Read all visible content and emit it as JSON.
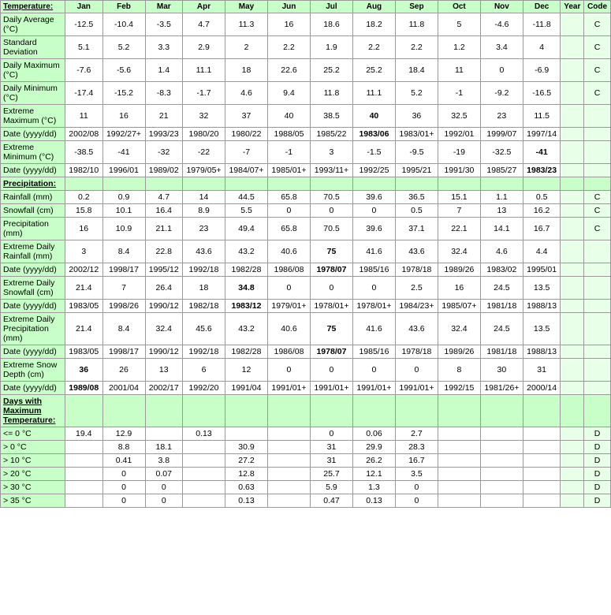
{
  "headers": {
    "row_label": "Temperature:",
    "months": [
      "Jan",
      "Feb",
      "Mar",
      "Apr",
      "May",
      "Jun",
      "Jul",
      "Aug",
      "Sep",
      "Oct",
      "Nov",
      "Dec",
      "Year",
      "Code"
    ]
  },
  "rows": [
    {
      "label": "Daily Average (°C)",
      "values": [
        "-12.5",
        "-10.4",
        "-3.5",
        "4.7",
        "11.3",
        "16",
        "18.6",
        "18.2",
        "11.8",
        "5",
        "-4.6",
        "-11.8",
        "",
        "C"
      ],
      "bold_indices": []
    },
    {
      "label": "Standard Deviation",
      "values": [
        "5.1",
        "5.2",
        "3.3",
        "2.9",
        "2",
        "2.2",
        "1.9",
        "2.2",
        "2.2",
        "1.2",
        "3.4",
        "4",
        "",
        "C"
      ],
      "bold_indices": []
    },
    {
      "label": "Daily Maximum (°C)",
      "values": [
        "-7.6",
        "-5.6",
        "1.4",
        "11.1",
        "18",
        "22.6",
        "25.2",
        "25.2",
        "18.4",
        "11",
        "0",
        "-6.9",
        "",
        "C"
      ],
      "bold_indices": []
    },
    {
      "label": "Daily Minimum (°C)",
      "values": [
        "-17.4",
        "-15.2",
        "-8.3",
        "-1.7",
        "4.6",
        "9.4",
        "11.8",
        "11.1",
        "5.2",
        "-1",
        "-9.2",
        "-16.5",
        "",
        "C"
      ],
      "bold_indices": []
    },
    {
      "label": "Extreme Maximum (°C)",
      "values": [
        "11",
        "16",
        "21",
        "32",
        "37",
        "40",
        "38.5",
        "40",
        "36",
        "32.5",
        "23",
        "11.5",
        "",
        ""
      ],
      "bold_indices": [
        7
      ]
    },
    {
      "label": "Date (yyyy/dd)",
      "values": [
        "2002/08",
        "1992/27+",
        "1993/23",
        "1980/20",
        "1980/22",
        "1988/05",
        "1985/22",
        "1983/06",
        "1983/01+",
        "1992/01",
        "1999/07",
        "1997/14",
        "",
        ""
      ],
      "bold_indices": [
        7
      ]
    },
    {
      "label": "Extreme Minimum (°C)",
      "values": [
        "-38.5",
        "-41",
        "-32",
        "-22",
        "-7",
        "-1",
        "3",
        "-1.5",
        "-9.5",
        "-19",
        "-32.5",
        "-41",
        "",
        ""
      ],
      "bold_indices": [
        11
      ]
    },
    {
      "label": "Date (yyyy/dd)",
      "values": [
        "1982/10",
        "1996/01",
        "1989/02",
        "1979/05+",
        "1984/07+",
        "1985/01+",
        "1993/11+",
        "1992/25",
        "1995/21",
        "1991/30",
        "1985/27",
        "1983/23",
        "",
        ""
      ],
      "bold_indices": [
        11
      ]
    },
    {
      "label": "Precipitation:",
      "section": true,
      "values": [
        "",
        "",
        "",
        "",
        "",
        "",
        "",
        "",
        "",
        "",
        "",
        "",
        "",
        ""
      ],
      "bold_indices": []
    },
    {
      "label": "Rainfall (mm)",
      "values": [
        "0.2",
        "0.9",
        "4.7",
        "14",
        "44.5",
        "65.8",
        "70.5",
        "39.6",
        "36.5",
        "15.1",
        "1.1",
        "0.5",
        "",
        "C"
      ],
      "bold_indices": []
    },
    {
      "label": "Snowfall (cm)",
      "values": [
        "15.8",
        "10.1",
        "16.4",
        "8.9",
        "5.5",
        "0",
        "0",
        "0",
        "0.5",
        "7",
        "13",
        "16.2",
        "",
        "C"
      ],
      "bold_indices": []
    },
    {
      "label": "Precipitation (mm)",
      "values": [
        "16",
        "10.9",
        "21.1",
        "23",
        "49.4",
        "65.8",
        "70.5",
        "39.6",
        "37.1",
        "22.1",
        "14.1",
        "16.7",
        "",
        "C"
      ],
      "bold_indices": []
    },
    {
      "label": "Extreme Daily Rainfall (mm)",
      "values": [
        "3",
        "8.4",
        "22.8",
        "43.6",
        "43.2",
        "40.6",
        "75",
        "41.6",
        "43.6",
        "32.4",
        "4.6",
        "4.4",
        "",
        ""
      ],
      "bold_indices": [
        6
      ]
    },
    {
      "label": "Date (yyyy/dd)",
      "values": [
        "2002/12",
        "1998/17",
        "1995/12",
        "1992/18",
        "1982/28",
        "1986/08",
        "1978/07",
        "1985/16",
        "1978/18",
        "1989/26",
        "1983/02",
        "1995/01",
        "",
        ""
      ],
      "bold_indices": [
        6
      ]
    },
    {
      "label": "Extreme Daily Snowfall (cm)",
      "values": [
        "21.4",
        "7",
        "26.4",
        "18",
        "34.8",
        "0",
        "0",
        "0",
        "2.5",
        "16",
        "24.5",
        "13.5",
        "",
        ""
      ],
      "bold_indices": [
        4
      ]
    },
    {
      "label": "Date (yyyy/dd)",
      "values": [
        "1983/05",
        "1998/26",
        "1990/12",
        "1982/18",
        "1983/12",
        "1979/01+",
        "1978/01+",
        "1978/01+",
        "1984/23+",
        "1985/07+",
        "1981/18",
        "1988/13",
        "",
        ""
      ],
      "bold_indices": [
        4
      ]
    },
    {
      "label": "Extreme Daily Precipitation (mm)",
      "values": [
        "21.4",
        "8.4",
        "32.4",
        "45.6",
        "43.2",
        "40.6",
        "75",
        "41.6",
        "43.6",
        "32.4",
        "24.5",
        "13.5",
        "",
        ""
      ],
      "bold_indices": [
        6
      ]
    },
    {
      "label": "Date (yyyy/dd)",
      "values": [
        "1983/05",
        "1998/17",
        "1990/12",
        "1992/18",
        "1982/28",
        "1986/08",
        "1978/07",
        "1985/16",
        "1978/18",
        "1989/26",
        "1981/18",
        "1988/13",
        "",
        ""
      ],
      "bold_indices": [
        6
      ]
    },
    {
      "label": "Extreme Snow Depth (cm)",
      "values": [
        "36",
        "26",
        "13",
        "6",
        "12",
        "0",
        "0",
        "0",
        "0",
        "8",
        "30",
        "31",
        "",
        ""
      ],
      "bold_indices": [
        0
      ]
    },
    {
      "label": "Date (yyyy/dd)",
      "values": [
        "1989/08",
        "2001/04",
        "2002/17",
        "1992/20",
        "1991/04",
        "1991/01+",
        "1991/01+",
        "1991/01+",
        "1991/01+",
        "1992/15",
        "1981/26+",
        "2000/14",
        "",
        ""
      ],
      "bold_indices": [
        0
      ]
    },
    {
      "label": "Days with Maximum Temperature:",
      "section": true,
      "values": [
        "",
        "",
        "",
        "",
        "",
        "",
        "",
        "",
        "",
        "",
        "",
        "",
        "",
        ""
      ],
      "bold_indices": []
    },
    {
      "label": "<= 0 °C",
      "values": [
        "19.4",
        "12.9",
        "",
        "0.13",
        "",
        "",
        "0",
        "0.06",
        "2.7",
        "",
        "",
        "",
        "",
        "D"
      ],
      "bold_indices": []
    },
    {
      "label": "> 0 °C",
      "values": [
        "",
        "8.8",
        "18.1",
        "",
        "30.9",
        "",
        "31",
        "29.9",
        "28.3",
        "",
        "",
        "",
        "",
        "D"
      ],
      "bold_indices": []
    },
    {
      "label": "> 10 °C",
      "values": [
        "",
        "0.41",
        "3.8",
        "",
        "27.2",
        "",
        "31",
        "26.2",
        "16.7",
        "",
        "",
        "",
        "",
        "D"
      ],
      "bold_indices": []
    },
    {
      "label": "> 20 °C",
      "values": [
        "",
        "0",
        "0.07",
        "",
        "12.8",
        "",
        "25.7",
        "12.1",
        "3.5",
        "",
        "",
        "",
        "",
        "D"
      ],
      "bold_indices": []
    },
    {
      "label": "> 30 °C",
      "values": [
        "",
        "0",
        "0",
        "",
        "0.63",
        "",
        "5.9",
        "1.3",
        "0",
        "",
        "",
        "",
        "",
        "D"
      ],
      "bold_indices": []
    },
    {
      "label": "> 35 °C",
      "values": [
        "",
        "0",
        "0",
        "",
        "0.13",
        "",
        "0.47",
        "0.13",
        "0",
        "",
        "",
        "",
        "",
        "D"
      ],
      "bold_indices": []
    }
  ]
}
